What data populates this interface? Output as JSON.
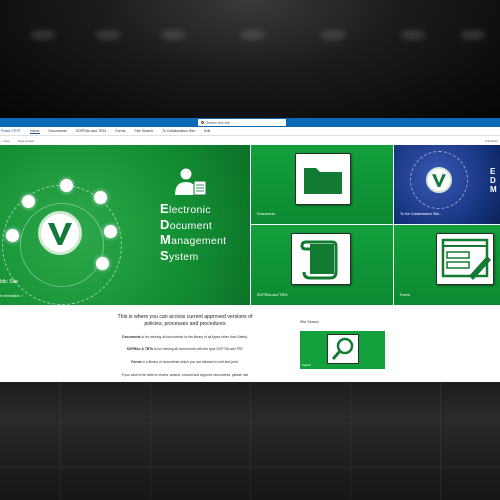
{
  "suite": {
    "search_placeholder": "Search this site"
  },
  "nav": {
    "site_name": "Public TEST",
    "items": [
      "Home",
      "Documents",
      "SOPRAs and TBTs",
      "Forms",
      "Site Search",
      "To Collaboration Site",
      "Edit"
    ]
  },
  "command_bar": {
    "new_label": "+ New",
    "items": [
      "Site contents",
      "Page details",
      "Analytics"
    ],
    "right_label": "Published"
  },
  "hero": {
    "title_lines": [
      {
        "cap": "E",
        "rest": "lectronic"
      },
      {
        "cap": "D",
        "rest": "ocument"
      },
      {
        "cap": "M",
        "rest": "anagement"
      },
      {
        "cap": "S",
        "rest": "ystem"
      }
    ],
    "caption": "blic Site",
    "subcaption": "re information ↗"
  },
  "tiles": {
    "documents": "Documents",
    "collaboration": "To the Collaboration Site...",
    "sopras": "SOPRAs and TBTs",
    "forms": "Forms"
  },
  "intro": {
    "heading": "This is where you can access current approved versions of policies, processes and procedures",
    "lines": [
      {
        "bold": "Documents",
        "rest": " is for viewing all documents in this library of all types other than Safety."
      },
      {
        "bold": "SOPRAs & TBTs",
        "rest": " is for viewing all documents with the type SOP RA and TBT."
      },
      {
        "bold": "Forms",
        "rest": " is a library of documents which you are allowed to edit and print."
      },
      {
        "bold": "",
        "rest": "If you wish to be able to review, amend, consult and approve documents, please use"
      }
    ]
  },
  "site_search": {
    "heading": "Site Search",
    "tile_label": "Search"
  },
  "colors": {
    "accent": "#0b6ab8",
    "tile_green": "#12a03c",
    "collab_blue": "#13327a"
  }
}
